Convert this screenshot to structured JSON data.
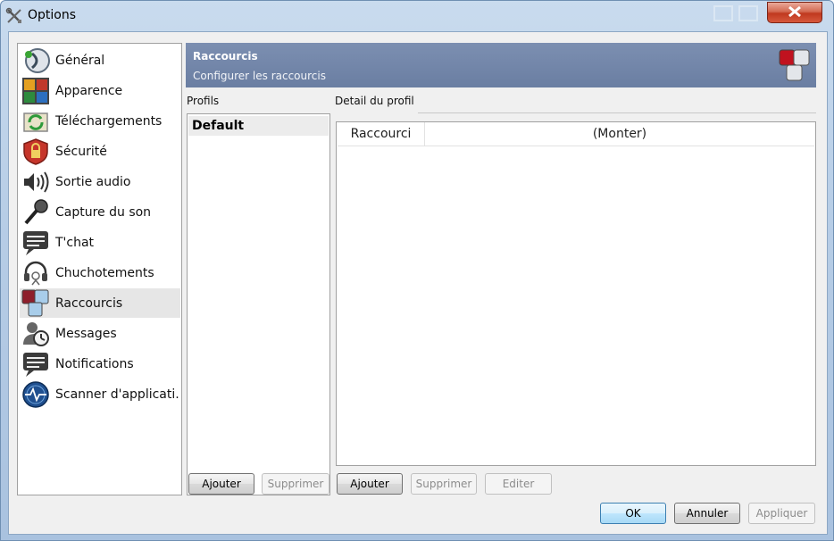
{
  "window": {
    "title": "Options"
  },
  "nav": {
    "items": [
      {
        "label": "Général",
        "icon": "general-icon"
      },
      {
        "label": "Apparence",
        "icon": "appearance-icon"
      },
      {
        "label": "Téléchargements",
        "icon": "downloads-icon"
      },
      {
        "label": "Sécurité",
        "icon": "security-icon"
      },
      {
        "label": "Sortie audio",
        "icon": "speaker-icon"
      },
      {
        "label": "Capture du son",
        "icon": "microphone-icon"
      },
      {
        "label": "T'chat",
        "icon": "chat-icon"
      },
      {
        "label": "Chuchotements",
        "icon": "headset-icon"
      },
      {
        "label": "Raccourcis",
        "icon": "shortcuts-icon",
        "selected": true
      },
      {
        "label": "Messages",
        "icon": "messages-icon"
      },
      {
        "label": "Notifications",
        "icon": "notifications-icon"
      },
      {
        "label": "Scanner d'applicati...",
        "icon": "scanner-icon"
      }
    ]
  },
  "banner": {
    "title": "Raccourcis",
    "subtitle": "Configurer les raccourcis"
  },
  "profiles": {
    "label": "Profils",
    "items": [
      "Default"
    ],
    "add_button": "Ajouter",
    "delete_button": "Supprimer"
  },
  "detail": {
    "label": "Detail du profil",
    "columns": [
      "Raccourci",
      "(Monter)"
    ],
    "add_button": "Ajouter",
    "delete_button": "Supprimer",
    "edit_button": "Editer"
  },
  "footer": {
    "ok": "OK",
    "cancel": "Annuler",
    "apply": "Appliquer"
  },
  "colors": {
    "banner": "#6a7ea2",
    "close_button": "#c0391f",
    "selected_row": "#e6e6e6"
  }
}
